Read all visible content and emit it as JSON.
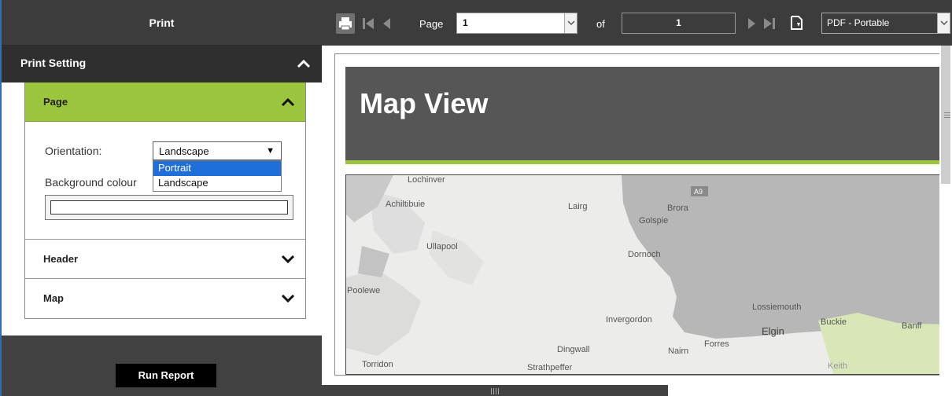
{
  "panel": {
    "title": "Print",
    "print_setting_label": "Print Setting",
    "sections": {
      "page": {
        "label": "Page",
        "orientation_label": "Orientation:",
        "orientation_value": "Landscape",
        "orientation_options": [
          "Portrait",
          "Landscape"
        ],
        "background_label": "Background colour",
        "background_value": ""
      },
      "header": {
        "label": "Header"
      },
      "map": {
        "label": "Map"
      }
    },
    "run_button": "Run Report"
  },
  "toolbar": {
    "page_label": "Page",
    "page_value": "1",
    "of_label": "of",
    "page_count": "1",
    "format_value": "PDF - Portable"
  },
  "document": {
    "title": "Map View",
    "map_labels": [
      {
        "text": "Lochinver"
      },
      {
        "text": "Achiltibuie"
      },
      {
        "text": "Lairg"
      },
      {
        "text": "Brora"
      },
      {
        "text": "Golspie"
      },
      {
        "text": "A9"
      },
      {
        "text": "Ullapool"
      },
      {
        "text": "Dornoch"
      },
      {
        "text": "Poolewe"
      },
      {
        "text": "Lossiemouth"
      },
      {
        "text": "Invergordon"
      },
      {
        "text": "Elgin"
      },
      {
        "text": "Buckie"
      },
      {
        "text": "Banff"
      },
      {
        "text": "Forres"
      },
      {
        "text": "Dingwall"
      },
      {
        "text": "Nairn"
      },
      {
        "text": "Torridon"
      },
      {
        "text": "Strathpeffer"
      },
      {
        "text": "Keith"
      }
    ]
  },
  "colors": {
    "accent_green": "#9bc53d",
    "panel_dark": "#414141",
    "header_grey": "#565656",
    "select_highlight": "#1e6fd9"
  },
  "icons": [
    "chevron-up-icon",
    "chevron-down-icon",
    "play-icon",
    "sliders-icon",
    "printer-icon",
    "first-page-icon",
    "prev-page-icon",
    "next-page-icon",
    "last-page-icon",
    "export-icon"
  ]
}
